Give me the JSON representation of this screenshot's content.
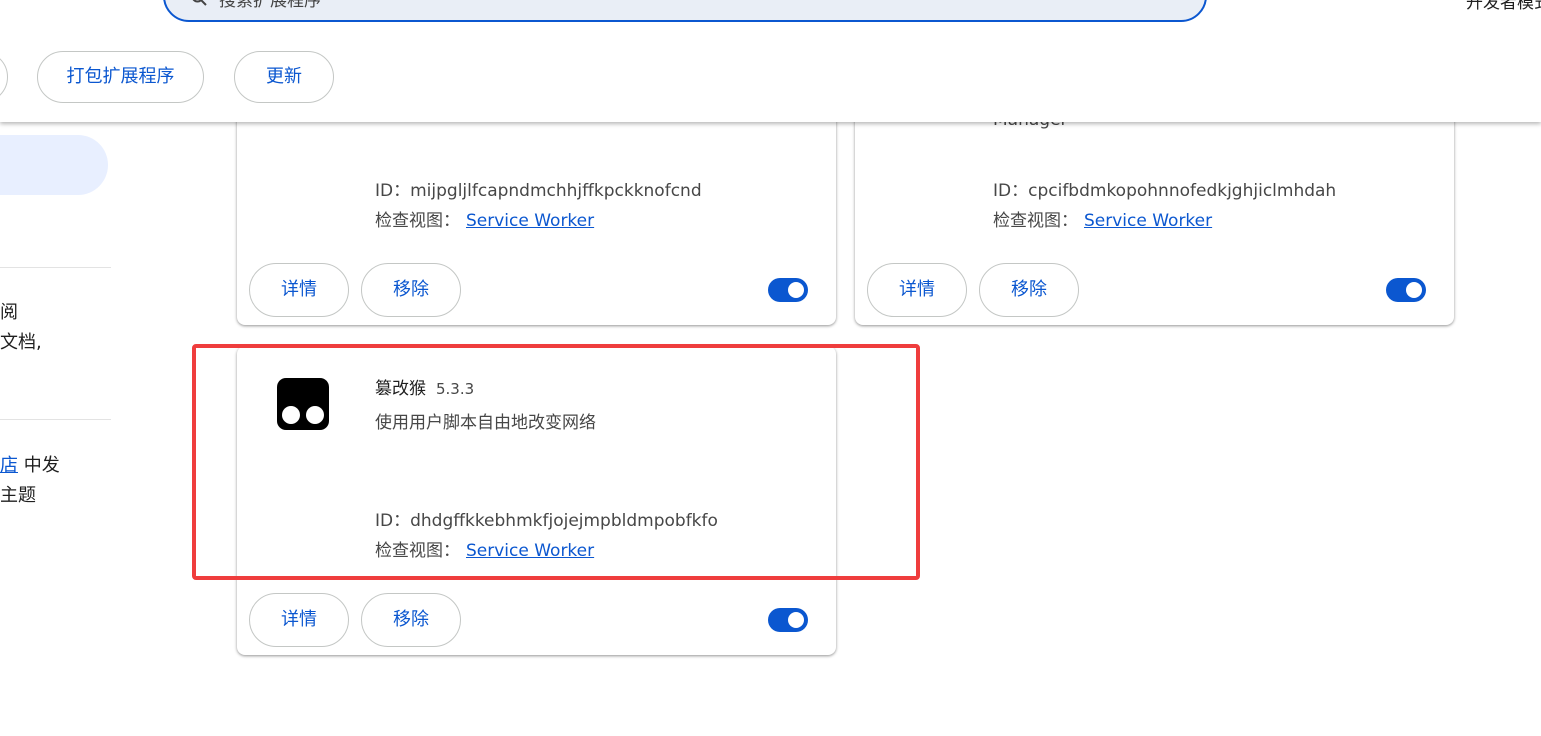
{
  "header": {
    "search_value": "搜索扩展程序",
    "dev_mode_label": "开发者模式",
    "buttons": {
      "pack_label": "打包扩展程序",
      "update_label": "更新"
    }
  },
  "sidebar": {
    "text_lines": [
      "阅",
      "文档,",
      "中发",
      "主题"
    ],
    "link_text": "店"
  },
  "cards": [
    {
      "partial_name": "",
      "id_label": "ID：",
      "id": "mijpgljlfcapndmchhjffkpckknofcnd",
      "view_label": "检查视图：",
      "view_link": "Service Worker",
      "details_label": "详情",
      "remove_label": "移除",
      "enabled": true
    },
    {
      "partial_name": "Manager",
      "id_label": "ID：",
      "id": "cpcifbdmkopohnnofedkjghjiclmhdah",
      "view_label": "检查视图：",
      "view_link": "Service Worker",
      "details_label": "详情",
      "remove_label": "移除",
      "enabled": true
    },
    {
      "name": "篡改猴",
      "version": "5.3.3",
      "description": "使用用户脚本自由地改变网络",
      "id_label": "ID：",
      "id": "dhdgffkkebhmkfjojejmpbldmpobfkfo",
      "view_label": "检查视图：",
      "view_link": "Service Worker",
      "details_label": "详情",
      "remove_label": "移除",
      "enabled": true,
      "icon": "tampermonkey-icon"
    }
  ],
  "colors": {
    "accent": "#0b57d0",
    "highlight": "#ef3d3d",
    "sidebar_selected": "#e8efff"
  }
}
